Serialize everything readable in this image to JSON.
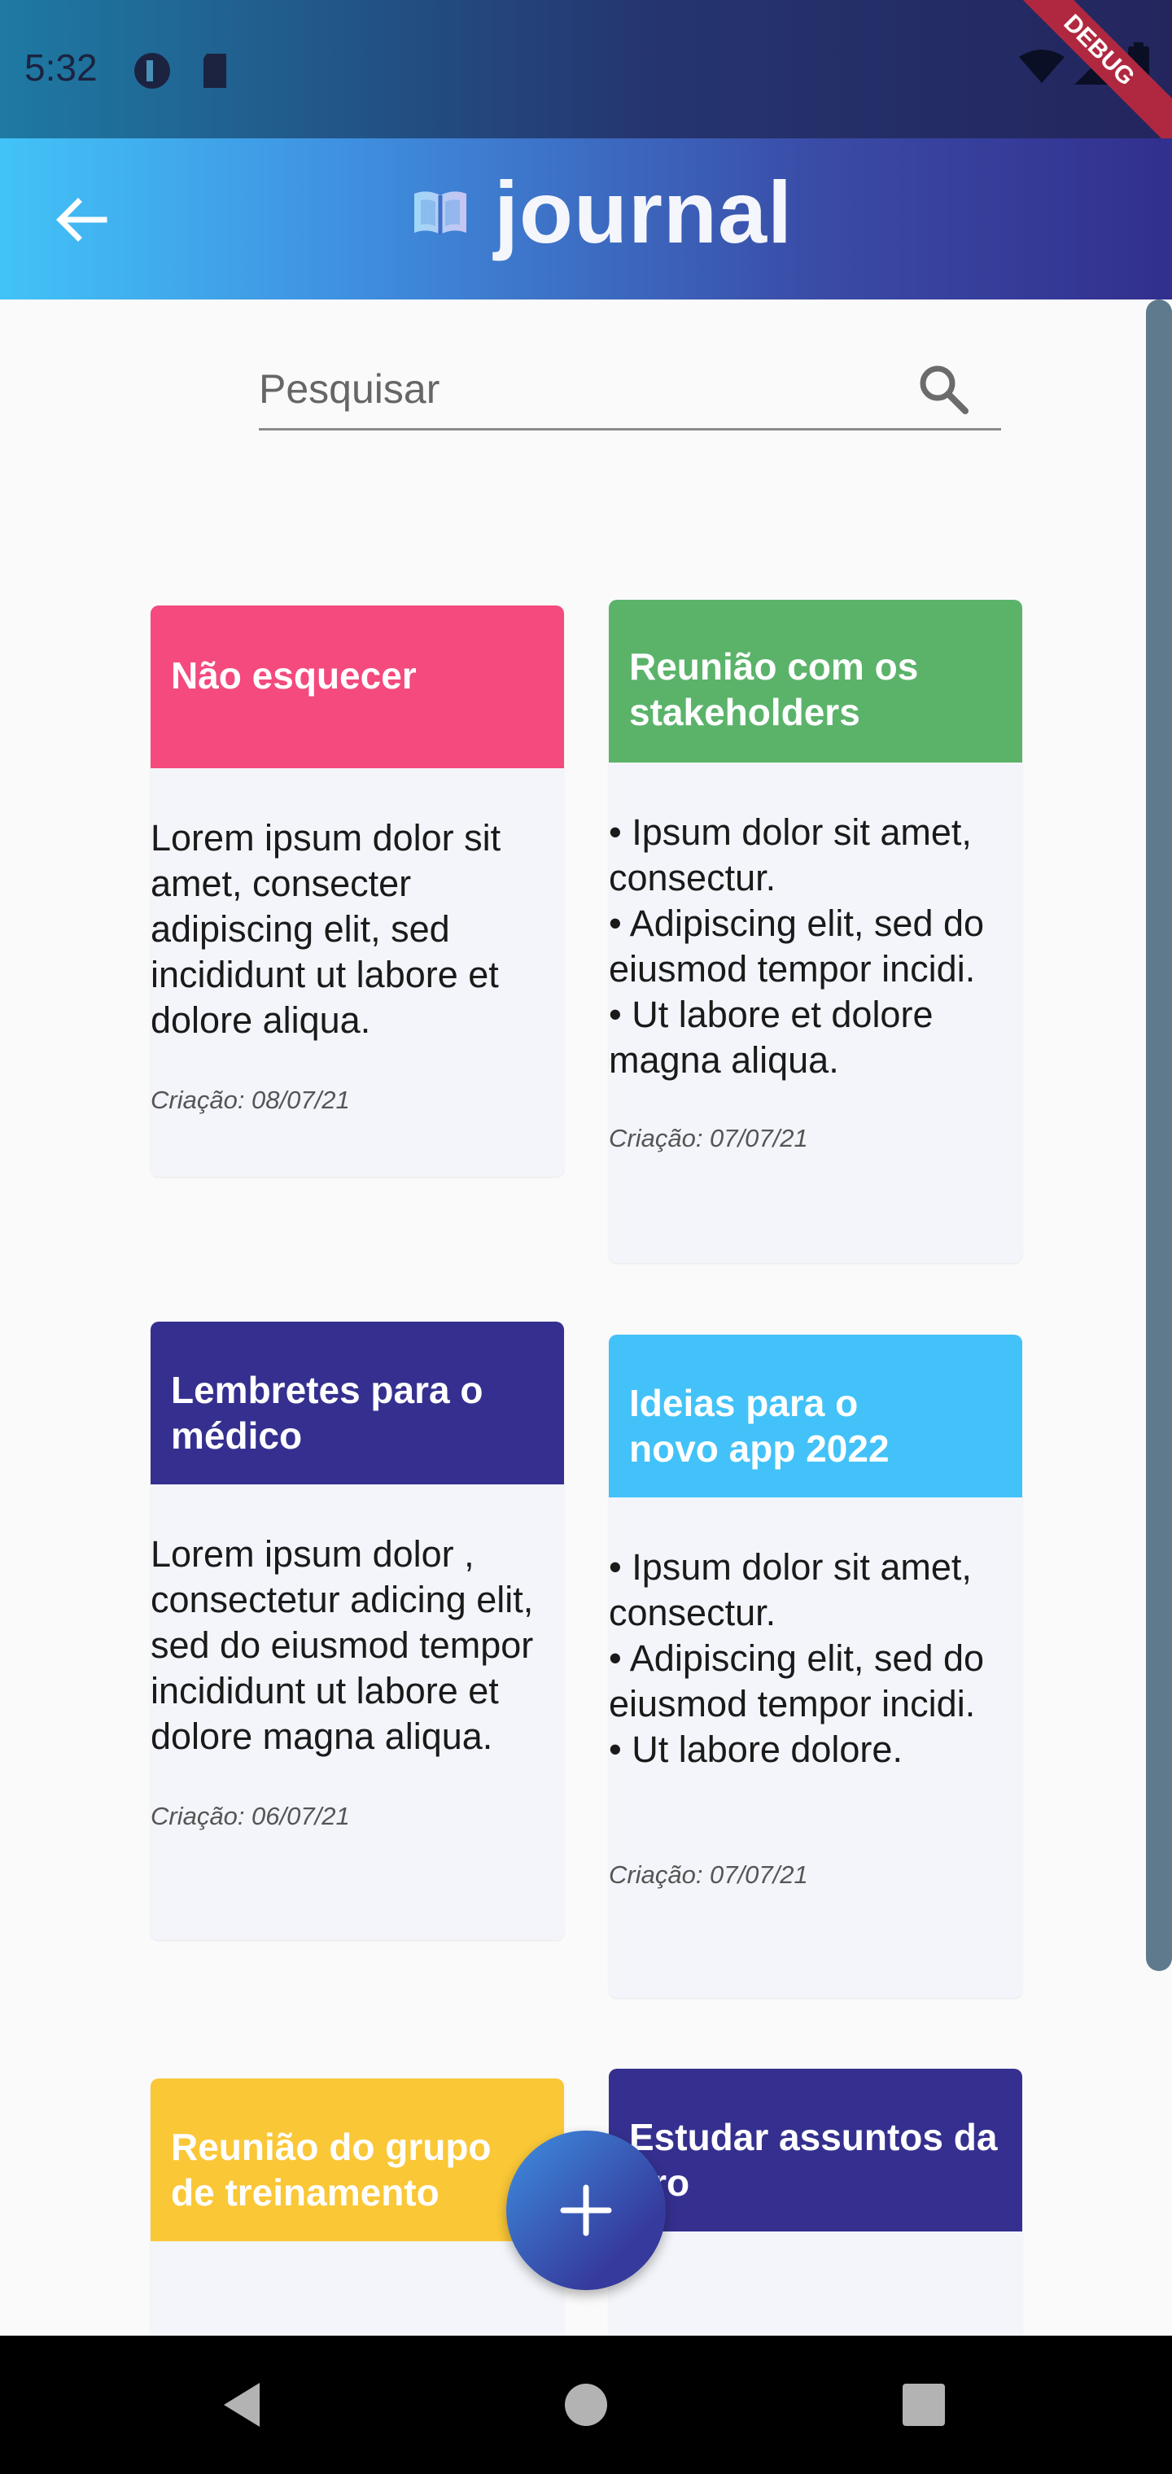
{
  "status_bar": {
    "time": "5:32",
    "debug_label": "DEBUG"
  },
  "app_bar": {
    "logo_text": "journal"
  },
  "search": {
    "placeholder": "Pesquisar"
  },
  "cards": [
    {
      "title": "Não esquecer",
      "color": "#f44a7d",
      "body": "Lorem ipsum dolor sit amet, consecter adipiscing elit, sed incididunt ut labore et dolore aliqua.",
      "date": "Criação: 08/07/21"
    },
    {
      "title": "Reunião com os stakeholders",
      "color": "#5bb36a",
      "body": "• Ipsum dolor sit amet, consectur.\n  • Adipiscing elit, sed do eiusmod tempor incidi.\n  • Ut labore et dolore magna aliqua.",
      "date": "Criação: 07/07/21"
    },
    {
      "title": "Lembretes para o médico",
      "color": "#35308f",
      "body": "Lorem ipsum dolor , consectetur adicing elit, sed do eiusmod tempor incididunt ut labore et dolore magna aliqua.",
      "date": "Criação: 06/07/21"
    },
    {
      "title": "Ideias para o novo app 2022",
      "color": "#42c2f8",
      "body": "• Ipsum dolor sit amet, consectur.\n • Adipiscing elit,   sed do eiusmod tempor incidi.\n • Ut labore dolore.",
      "date": "Criação: 07/07/21"
    },
    {
      "title": "Reunião do grupo de treinamento",
      "color": "#fac737",
      "body": "",
      "date": ""
    },
    {
      "title": "Estudar assuntos da pro",
      "color": "#35308f",
      "body": "",
      "date": ""
    }
  ]
}
